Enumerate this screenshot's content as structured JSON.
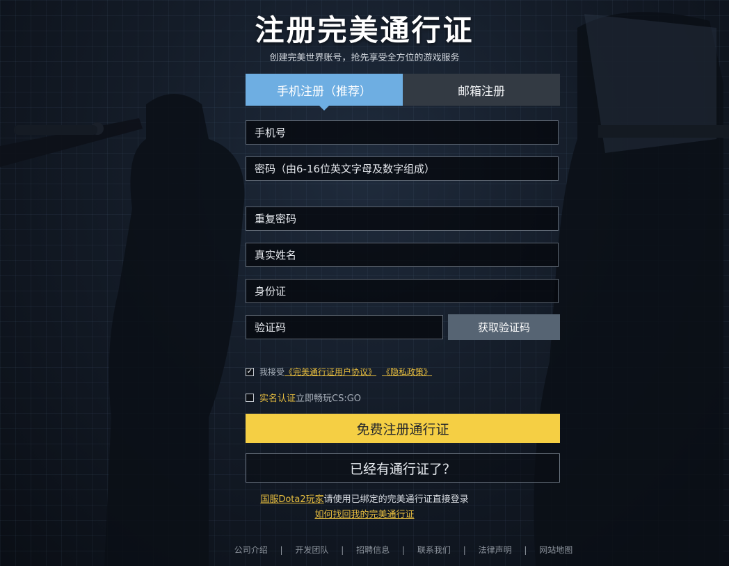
{
  "header": {
    "title": "注册完美通行证",
    "subtitle": "创建完美世界账号，抢先享受全方位的游戏服务"
  },
  "tabs": [
    {
      "label": "手机注册（推荐）",
      "active": true
    },
    {
      "label": "邮箱注册",
      "active": false
    }
  ],
  "form": {
    "phone_placeholder": "手机号",
    "password_placeholder": "密码（由6-16位英文字母及数字组成）",
    "repeat_password_placeholder": "重复密码",
    "real_name_placeholder": "真实姓名",
    "id_card_placeholder": "身份证",
    "captcha_placeholder": "验证码",
    "get_code_label": "获取验证码"
  },
  "agreement": {
    "checked": true,
    "prefix": "我接受",
    "user_agreement": "《完美通行证用户协议》",
    "privacy_policy": "《隐私政策》"
  },
  "realname": {
    "checked": false,
    "highlight": "实名认证",
    "rest": "立即畅玩CS:GO"
  },
  "buttons": {
    "register": "免费注册通行证",
    "have_account": "已经有通行证了？"
  },
  "dota": {
    "link": "国服Dota2玩家",
    "text": "请使用已绑定的完美通行证直接登录"
  },
  "recover_link": "如何找回我的完美通行证",
  "footer": {
    "links": [
      "公司介绍",
      "开发团队",
      "招聘信息",
      "联系我们",
      "法律声明",
      "网站地图"
    ],
    "separator": "|"
  },
  "colors": {
    "accent_tab": "#6eaee2",
    "primary_button": "#f5cf44",
    "link_gold": "#e8be3f",
    "code_button": "#566473"
  }
}
